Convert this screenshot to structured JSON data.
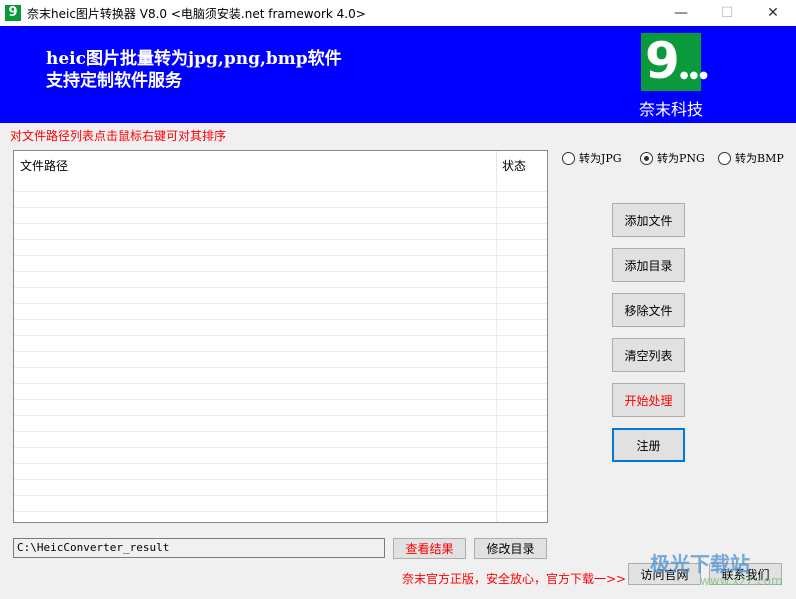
{
  "window": {
    "title": "奈末heic图片转换器 V8.0 <电脑须安装.net framework 4.0>",
    "icon": "9",
    "minimize": "—",
    "maximize": "☐",
    "close": "✕"
  },
  "banner": {
    "line1": "heic图片批量转为jpg,png,bmp软件",
    "line2": "支持定制软件服务",
    "logo_mark": "9",
    "logo_dots": "●●●",
    "company": "奈末科技"
  },
  "hint": "对文件路径列表点击鼠标右键可对其排序",
  "table": {
    "columns": [
      "文件路径",
      "状态"
    ],
    "rows": []
  },
  "format": {
    "options": [
      "转为JPG",
      "转为PNG",
      "转为BMP"
    ],
    "selected": "转为PNG"
  },
  "buttons": {
    "add_file": "添加文件",
    "add_dir": "添加目录",
    "remove_file": "移除文件",
    "clear_list": "清空列表",
    "start": "开始处理",
    "register": "注册",
    "view_result": "查看结果",
    "change_dir": "修改目录",
    "visit_site": "访问官网",
    "contact": "联系我们"
  },
  "output_path": "C:\\HeicConverter_result",
  "promo": "奈末官方正版，安全放心，官方下载一>>",
  "watermark": {
    "name": "极光下载站",
    "url": "www.xz7.com"
  },
  "colors": {
    "banner": "#0000ff",
    "logo": "#0a9a3c",
    "accent_red": "#ff0000",
    "focus": "#0078d7"
  }
}
